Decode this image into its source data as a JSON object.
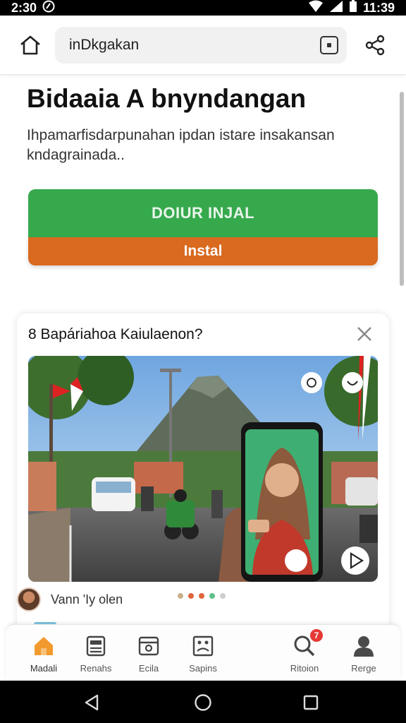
{
  "status_bar": {
    "time": "2:30",
    "clock": "11:39"
  },
  "browser": {
    "url": "inDkgakan"
  },
  "page": {
    "title": "Bidaaia A bnyndangan",
    "description": "Ihpamarfisdarpunahan ipdan istare insakansan kndagrainada..",
    "primary_button": "DOIUR INJAL",
    "secondary_button": "Instal"
  },
  "card": {
    "title": "8  Bapáriahoa Kaiulaenon?",
    "poster_name": "Vann 'Iy olen",
    "carousel_dots": [
      "#c8b08a",
      "#e0643c",
      "#e0643c",
      "#5fbf88",
      "#cfcfcf"
    ]
  },
  "bottom_nav": {
    "items": [
      {
        "label": "Madali",
        "icon": "home-icon"
      },
      {
        "label": "Renahs",
        "icon": "news-icon"
      },
      {
        "label": "Ecila",
        "icon": "wallet-icon"
      },
      {
        "label": "Sapins",
        "icon": "gallery-icon"
      },
      {
        "label": "Ritoion",
        "icon": "search-icon",
        "badge": "7"
      },
      {
        "label": "Rerge",
        "icon": "profile-icon"
      }
    ]
  },
  "colors": {
    "primary_green": "#36a94d",
    "install_orange": "#d96a1f",
    "active_nav": "#f29a2e",
    "badge_red": "#e53935"
  }
}
